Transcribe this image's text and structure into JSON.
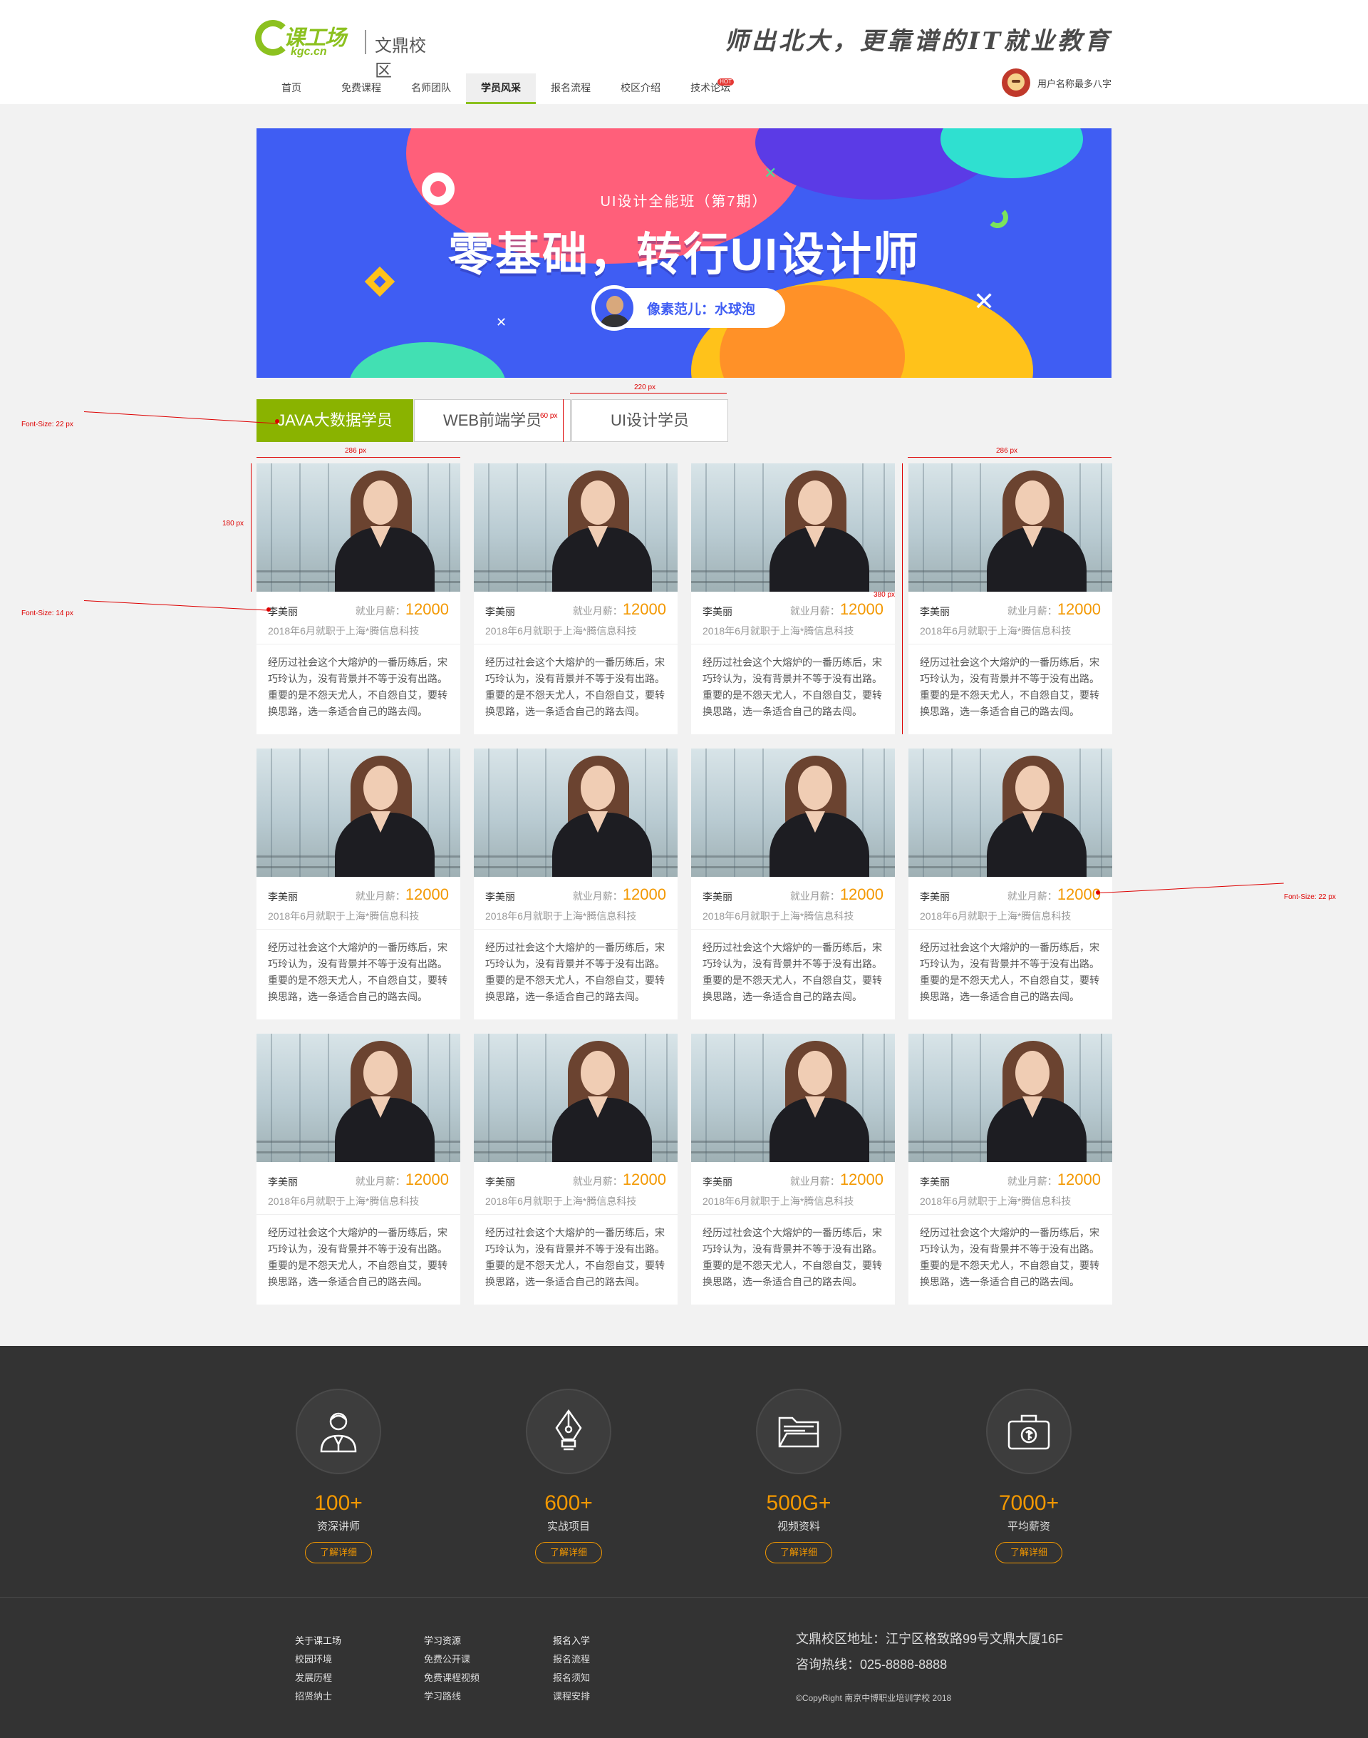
{
  "header": {
    "logo_name": "课工场",
    "logo_domain": "kgc.cn",
    "campus": "文鼎校区",
    "slogan": "师出北大，更靠谱的IT就业教育",
    "nav": [
      {
        "label": "首页"
      },
      {
        "label": "免费课程"
      },
      {
        "label": "名师团队"
      },
      {
        "label": "学员风采"
      },
      {
        "label": "报名流程"
      },
      {
        "label": "校区介绍"
      },
      {
        "label": "技术论坛"
      }
    ],
    "active_nav": "学员风采",
    "hot_badge": "HOT",
    "user_name": "用户名称最多八字"
  },
  "banner": {
    "subtitle": "UI设计全能班（第7期）",
    "title": "零基础，转行UI设计师",
    "teacher": "像素范儿：水球泡"
  },
  "tabs": [
    {
      "label": "JAVA大数据学员"
    },
    {
      "label": "WEB前端学员"
    },
    {
      "label": "UI设计学员"
    }
  ],
  "card": {
    "name": "李美丽",
    "salary_label": "就业月薪：",
    "salary": "12000",
    "job": "2018年6月就职于上海*腾信息科技",
    "desc": "经历过社会这个大熔炉的一番历练后，宋巧玲认为，没有背景并不等于没有出路。重要的是不怨天尤人，不自怨自艾，要转换思路，选一条适合自己的路去闯。"
  },
  "annotations": {
    "tab_font": "Font-Size: 22 px",
    "name_font": "Font-Size: 14 px",
    "salary_font": "Font-Size: 22 px",
    "tab_width": "220 px",
    "tab_height": "60 px",
    "card_width_left": "286 px",
    "card_width_right": "286 px",
    "photo_height": "180 px",
    "card_height": "380 px"
  },
  "stats": [
    {
      "icon": "teacher-icon",
      "num": "100+",
      "label": "资深讲师",
      "btn": "了解详细"
    },
    {
      "icon": "pen-nib-icon",
      "num": "600+",
      "label": "实战项目",
      "btn": "了解详细"
    },
    {
      "icon": "folder-icon",
      "num": "500G+",
      "label": "视频资料",
      "btn": "了解详细"
    },
    {
      "icon": "briefcase-money-icon",
      "num": "7000+",
      "label": "平均薪资",
      "btn": "了解详细"
    }
  ],
  "footer": {
    "col1": [
      "关于课工场",
      "校园环境",
      "发展历程",
      "招贤纳士"
    ],
    "col2": [
      "学习资源",
      "免费公开课",
      "免费课程视频",
      "学习路线"
    ],
    "col3": [
      "报名入学",
      "报名流程",
      "报名须知",
      "课程安排"
    ],
    "address": "文鼎校区地址：江宁区格致路99号文鼎大厦16F",
    "hotline": "咨询热线：025-8888-8888",
    "copyright": "©CopyRight  南京中博职业培训学校  2018"
  },
  "colors": {
    "brand": "#8ab300",
    "accent": "#f39800",
    "footer_bg": "#333333"
  }
}
